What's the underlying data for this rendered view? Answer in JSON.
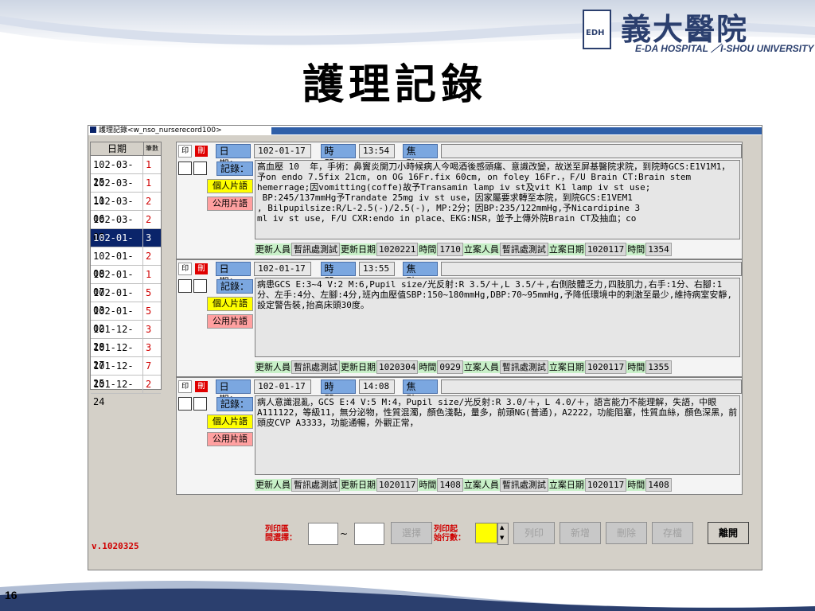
{
  "slide": {
    "title": "護理記錄",
    "page_number": "16",
    "logo_cjk": "義大醫院",
    "logo_abbr": "EDH",
    "logo_en": "E-DA HOSPITAL ／I-SHOU UNIVERSITY"
  },
  "window": {
    "title": "護理記錄<w_nso_nurserecord100>"
  },
  "list": {
    "header_date": "日期",
    "header_count": "筆數",
    "rows": [
      {
        "date": "102-03-25",
        "count": "1"
      },
      {
        "date": "102-03-11",
        "count": "1"
      },
      {
        "date": "102-03-06",
        "count": "2"
      },
      {
        "date": "102-03-05",
        "count": "2"
      },
      {
        "date": "102-01-17",
        "count": "3"
      },
      {
        "date": "102-01-08",
        "count": "2"
      },
      {
        "date": "102-01-07",
        "count": "1"
      },
      {
        "date": "102-01-03",
        "count": "5"
      },
      {
        "date": "102-01-02",
        "count": "5"
      },
      {
        "date": "101-12-28",
        "count": "3"
      },
      {
        "date": "101-12-27",
        "count": "3"
      },
      {
        "date": "101-12-25",
        "count": "7"
      },
      {
        "date": "101-12-24",
        "count": "2"
      }
    ]
  },
  "labels": {
    "print": "印",
    "delete": "刪",
    "date": "日期：",
    "time": "時間：",
    "focus": "焦點：",
    "record": "記錄：",
    "personal_phrase": "個人片語",
    "public_phrase": "公用片語",
    "updater": "更新人員",
    "updater_unit": "暫訊處測試",
    "update_date": "更新日期",
    "time_short": "時間",
    "creator": "立案人員",
    "create_date": "立案日期"
  },
  "records": [
    {
      "date": "102-01-17",
      "time": "13:54",
      "text": "高血壓 10  年，手術：鼻竇炎開刀小時候病人今喝酒後感頭痛、意識改變，故送至屏基醫院求院，到院時GCS:E1V1M1，予on endo 7.5fix 21cm, on OG 16Fr.fix 60cm, on foley 16Fr.，F/U Brain CT:Brain stem\nhemerrage;因vomitting(coffe)故予Transamin lamp iv st及vit K1 lamp iv st use;\n BP:245/137mmHg予Trandate 25mg iv st use，因家屬要求轉至本院，到院GCS:E1VEM1\n, Bilpupilsize:R/L-2.5(-)/2.5(-), MP:2分；因BP:235/122mmHg,予Nicardipine 3\nml iv st use, F/U CXR:endo in place、EKG:NSR，並予上傳外院Brain CT及抽血；co",
      "upd_date": "1020221",
      "upd_time": "1710",
      "cre_date": "1020117",
      "cre_time": "1354"
    },
    {
      "date": "102-01-17",
      "time": "13:55",
      "text": "病患GCS E:3~4 V:2 M:6,Pupil size/光反射:R 3.5/＋,L 3.5/＋,右側肢體乏力,四肢肌力,右手:1分、右腳:1分、左手:4分、左腳:4分,班內血壓值SBP:150~180mmHg,DBP:70~95mmHg,予降低環境中的刺激至最少,維持病室安靜,設定警告裝,抬高床頭30度。",
      "upd_date": "1020304",
      "upd_time": "0929",
      "cre_date": "1020117",
      "cre_time": "1355"
    },
    {
      "date": "102-01-17",
      "time": "14:08",
      "text": "病人意識混亂，GCS E:4 V:5 M:4，Pupil size/光反射:R 3.0/＋，L 4.0/＋，語言能力不能理解，失語，中眼A111122，等級11，無分泌物，性質混濁，顏色淺黏，量多，前頭NG(普通)，A2222，功能阻塞，性質血絲，顏色深黑，前頭皮CVP A3333，功能通暢，外觀正常，",
      "upd_date": "1020117",
      "upd_time": "1408",
      "cre_date": "1020117",
      "cre_time": "1408"
    }
  ],
  "bottom": {
    "version": "v.1020325",
    "range_label_1": "列印區",
    "range_label_2": "間選擇：",
    "tilde": "~",
    "select_btn": "選擇",
    "start_label_1": "列印起",
    "start_label_2": "始行數：",
    "print_btn": "列印",
    "add_btn": "新增",
    "delete_btn": "刪除",
    "save_btn": "存檔",
    "exit_btn": "離開"
  },
  "colors": {
    "selected_row": "#0a246a",
    "count_red": "#d00000",
    "label_blue": "#7ba7e0",
    "personal_yellow": "#ffff00",
    "public_pink": "#ffa0a0",
    "meta_green": "#c8f0c8"
  }
}
